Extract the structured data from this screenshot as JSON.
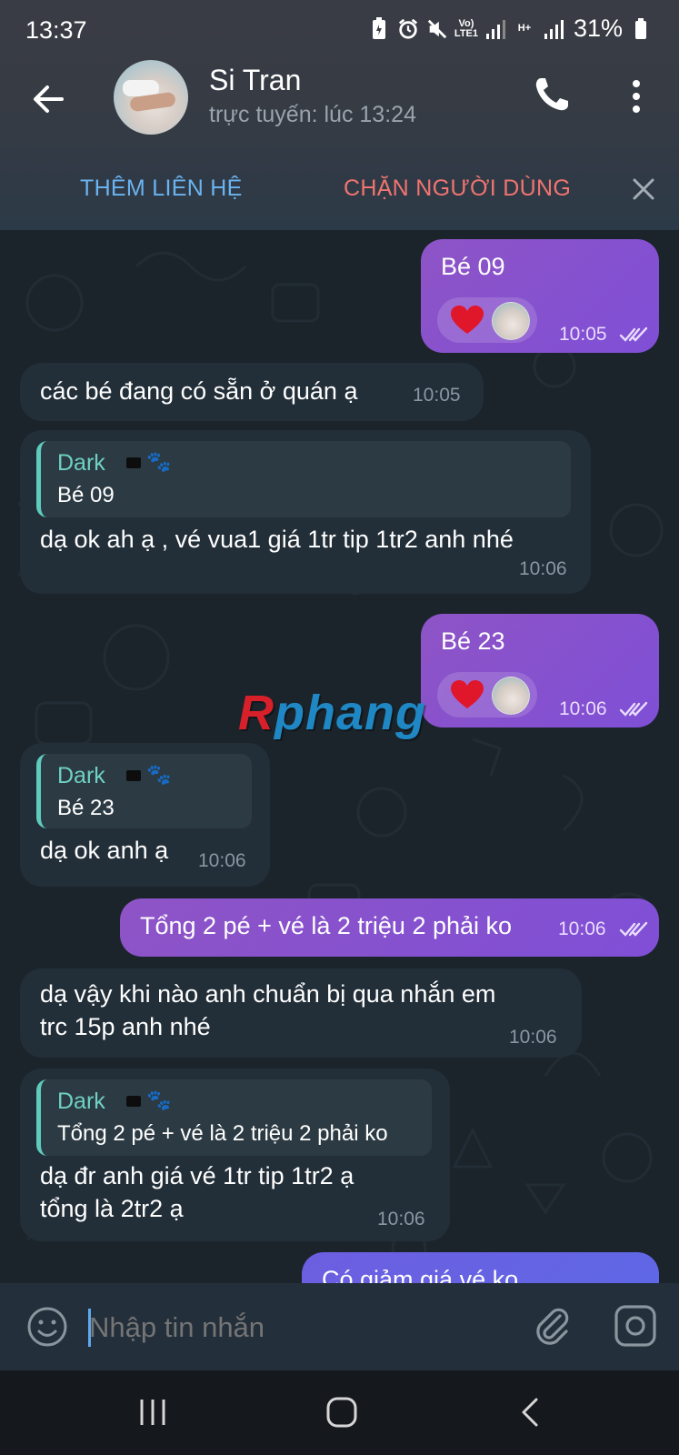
{
  "status_bar": {
    "time": "13:37",
    "net_top": "Vo)",
    "net_bottom": "LTE1",
    "net2": "H+",
    "battery": "31%"
  },
  "header": {
    "name": "Si Tran",
    "status": "trực tuyến: lúc 13:24"
  },
  "action_bar": {
    "add_contact": "THÊM LIÊN HỆ",
    "block_user": "CHẶN NGƯỜI DÙNG"
  },
  "messages": [
    {
      "dir": "out",
      "text": "Bé 09",
      "time": "10:05",
      "reaction": "heart"
    },
    {
      "dir": "in",
      "text": "các bé đang có sẵn ở quán ạ",
      "time": "10:05"
    },
    {
      "dir": "in",
      "reply_name": "Dark",
      "reply_text": "Bé 09",
      "text": "dạ ok ah ạ , vé vua1 giá 1tr tip 1tr2 anh nhé",
      "time": "10:06"
    },
    {
      "dir": "out",
      "text": "Bé 23",
      "time": "10:06",
      "reaction": "heart"
    },
    {
      "dir": "in",
      "reply_name": "Dark",
      "reply_text": "Bé 23",
      "text": "dạ ok anh ạ",
      "time": "10:06"
    },
    {
      "dir": "out",
      "text": "Tổng 2 pé + vé là 2 triệu 2 phải ko",
      "time": "10:06"
    },
    {
      "dir": "in",
      "text_lines": [
        "dạ vậy khi nào anh chuẩn bị qua nhắn em",
        "trc 15p anh nhé"
      ],
      "time": "10:06"
    },
    {
      "dir": "in",
      "reply_name": "Dark",
      "reply_text": "Tổng 2 pé + vé là 2 triệu 2 phải ko",
      "text_lines": [
        "dạ đr anh giá vé 1tr tip 1tr2 ạ",
        "tổng là 2tr2 ạ"
      ],
      "time": "10:06"
    },
    {
      "dir": "out",
      "text": "Có giảm giá vé ko",
      "time": ""
    }
  ],
  "watermark": {
    "first": "R",
    "rest": "phang"
  },
  "input": {
    "placeholder": "Nhập tin nhắn"
  },
  "colors": {
    "outgoing": "#8e54c6",
    "incoming": "#222e38",
    "accent": "#6fd0c3",
    "block": "#f07470",
    "add": "#6bb3f0"
  },
  "icons": [
    "back-arrow-icon",
    "phone-icon",
    "more-vertical-icon",
    "close-icon",
    "heart-icon",
    "double-check-icon",
    "emoji-icon",
    "paperclip-icon",
    "camera-icon",
    "recent-apps-icon",
    "home-icon",
    "back-nav-icon"
  ]
}
